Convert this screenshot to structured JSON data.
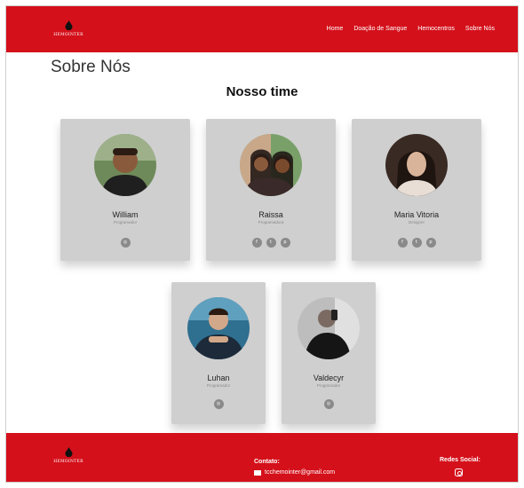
{
  "header": {
    "logo_text": "HEMOINTER",
    "nav": [
      "Home",
      "Doação de Sangue",
      "Hemocentros",
      "Sobre Nós"
    ]
  },
  "page": {
    "title": "Sobre Nós",
    "section_title": "Nosso time"
  },
  "team": [
    {
      "name": "William",
      "role": "Programador",
      "social": [
        "instagram-icon"
      ]
    },
    {
      "name": "Raissa",
      "role": "Programadora",
      "social": [
        "facebook-icon",
        "twitter-icon",
        "pinterest-icon"
      ]
    },
    {
      "name": "Maria Vitoria",
      "role": "Designer",
      "social": [
        "facebook-icon",
        "twitter-icon",
        "pinterest-icon"
      ]
    },
    {
      "name": "Luhan",
      "role": "Programador",
      "social": [
        "instagram-icon"
      ]
    },
    {
      "name": "Valdecyr",
      "role": "Programador",
      "social": [
        "instagram-icon"
      ]
    }
  ],
  "footer": {
    "logo_text": "HEMOINTER",
    "contact_label": "Contato:",
    "email": "tcchemointer@gmail.com",
    "social_label": "Redes Social:",
    "social_icon": "instagram-icon"
  },
  "colors": {
    "brand_red": "#d4101a",
    "card_gray": "#cfcfcf",
    "icon_gray": "#8a8a8a"
  }
}
